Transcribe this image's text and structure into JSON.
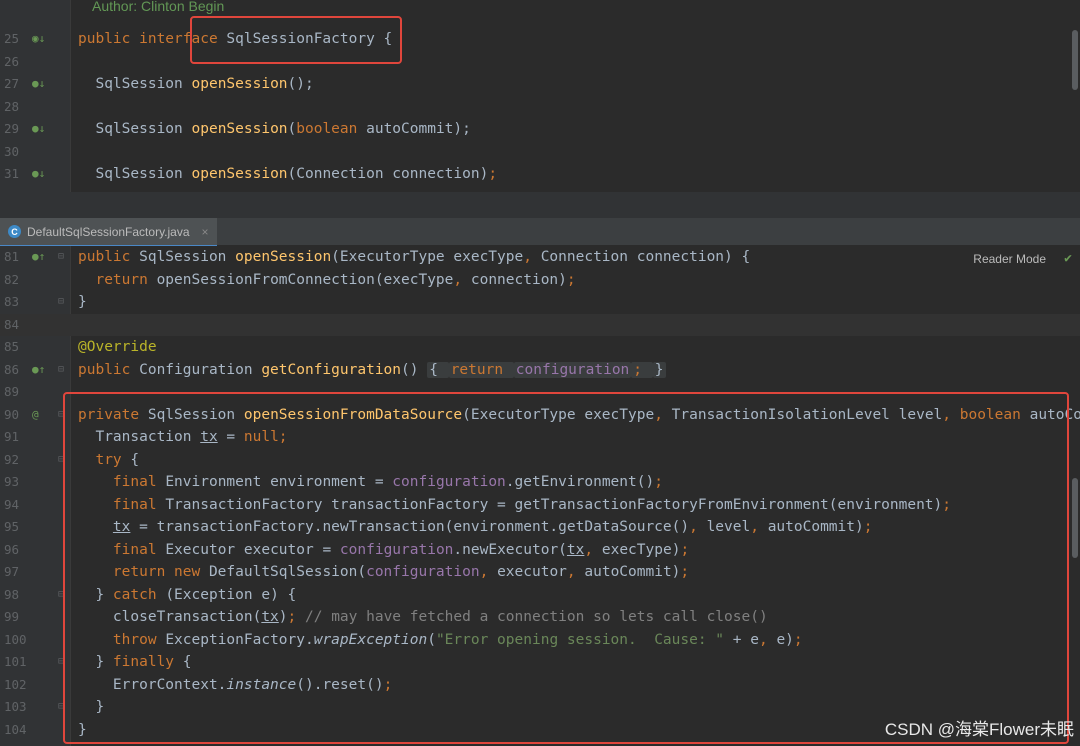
{
  "top": {
    "header_comment": "Author: Clinton Begin",
    "lines": [
      {
        "n": "25",
        "parts": [
          [
            "kw",
            "public interface "
          ],
          [
            "",
            "SqlSessionFactory {"
          ]
        ]
      },
      {
        "n": "26",
        "parts": []
      },
      {
        "n": "27",
        "parts": [
          [
            "",
            "  SqlSession "
          ],
          [
            "fn",
            "openSession"
          ],
          [
            "",
            "();"
          ]
        ]
      },
      {
        "n": "28",
        "parts": []
      },
      {
        "n": "29",
        "parts": [
          [
            "",
            "  SqlSession "
          ],
          [
            "fn",
            "openSession"
          ],
          [
            "",
            "("
          ],
          [
            "kw",
            "boolean "
          ],
          [
            "",
            "autoCommit);"
          ]
        ]
      },
      {
        "n": "30",
        "parts": []
      },
      {
        "n": "31",
        "parts": [
          [
            "",
            "  SqlSession "
          ],
          [
            "fn",
            "openSession"
          ],
          [
            "",
            "(Connection connection)"
          ],
          [
            "kw",
            ";"
          ]
        ]
      }
    ]
  },
  "tab": {
    "label": "DefaultSqlSessionFactory.java",
    "close": "×"
  },
  "reader_mode": "Reader Mode",
  "bottom": {
    "lines": [
      {
        "n": "81",
        "parts": [
          [
            "kw",
            "public "
          ],
          [
            "",
            "SqlSession "
          ],
          [
            "fn",
            "openSession"
          ],
          [
            "",
            "(ExecutorType execType"
          ],
          [
            "kw",
            ", "
          ],
          [
            "",
            "Connection connection) {"
          ]
        ]
      },
      {
        "n": "82",
        "parts": [
          [
            "kw",
            "  return "
          ],
          [
            "",
            "openSessionFromConnection(execType"
          ],
          [
            "kw",
            ", "
          ],
          [
            "",
            "connection)"
          ],
          [
            "kw",
            ";"
          ]
        ]
      },
      {
        "n": "83",
        "parts": [
          [
            "",
            "}"
          ]
        ]
      },
      {
        "n": "84",
        "parts": []
      },
      {
        "n": "85",
        "parts": [
          [
            "ann",
            "@Override"
          ]
        ]
      },
      {
        "n": "86",
        "parts": [
          [
            "kw",
            "public "
          ],
          [
            "",
            "Configuration "
          ],
          [
            "fn",
            "getConfiguration"
          ],
          [
            "",
            "() "
          ],
          [
            "box",
            "{ "
          ],
          [
            "kwbox",
            "return "
          ],
          [
            "fldbox",
            "configuration"
          ],
          [
            "kwbox",
            "; "
          ],
          [
            "box",
            "}"
          ]
        ]
      },
      {
        "n": "89",
        "parts": []
      },
      {
        "n": "90",
        "parts": [
          [
            "kw",
            "private "
          ],
          [
            "",
            "SqlSession "
          ],
          [
            "fn",
            "openSessionFromDataSource"
          ],
          [
            "",
            "(ExecutorType execType"
          ],
          [
            "kw",
            ", "
          ],
          [
            "",
            "TransactionIsolationLevel level"
          ],
          [
            "kw",
            ", boolean "
          ],
          [
            "",
            "autoCommit) {"
          ]
        ]
      },
      {
        "n": "91",
        "parts": [
          [
            "",
            "  Transaction "
          ],
          [
            "ul",
            "tx"
          ],
          [
            "",
            " = "
          ],
          [
            "kw",
            "null;"
          ]
        ]
      },
      {
        "n": "92",
        "parts": [
          [
            "kw",
            "  try "
          ],
          [
            "",
            "{"
          ]
        ]
      },
      {
        "n": "93",
        "parts": [
          [
            "kw",
            "    final "
          ],
          [
            "",
            "Environment environment = "
          ],
          [
            "fld",
            "configuration"
          ],
          [
            "",
            ".getEnvironment()"
          ],
          [
            "kw",
            ";"
          ]
        ]
      },
      {
        "n": "94",
        "parts": [
          [
            "kw",
            "    final "
          ],
          [
            "",
            "TransactionFactory transactionFactory = getTransactionFactoryFromEnvironment(environment)"
          ],
          [
            "kw",
            ";"
          ]
        ]
      },
      {
        "n": "95",
        "parts": [
          [
            "",
            "    "
          ],
          [
            "ul",
            "tx"
          ],
          [
            "",
            " = transactionFactory.newTransaction(environment.getDataSource()"
          ],
          [
            "kw",
            ", "
          ],
          [
            "",
            "level"
          ],
          [
            "kw",
            ", "
          ],
          [
            "",
            "autoCommit)"
          ],
          [
            "kw",
            ";"
          ]
        ]
      },
      {
        "n": "96",
        "parts": [
          [
            "kw",
            "    final "
          ],
          [
            "",
            "Executor executor = "
          ],
          [
            "fld",
            "configuration"
          ],
          [
            "",
            ".newExecutor("
          ],
          [
            "ul",
            "tx"
          ],
          [
            "kw",
            ", "
          ],
          [
            "",
            "execType)"
          ],
          [
            "kw",
            ";"
          ]
        ]
      },
      {
        "n": "97",
        "parts": [
          [
            "kw",
            "    return new "
          ],
          [
            "",
            "DefaultSqlSession("
          ],
          [
            "fld",
            "configuration"
          ],
          [
            "kw",
            ", "
          ],
          [
            "",
            "executor"
          ],
          [
            "kw",
            ", "
          ],
          [
            "",
            "autoCommit)"
          ],
          [
            "kw",
            ";"
          ]
        ]
      },
      {
        "n": "98",
        "parts": [
          [
            "",
            "  } "
          ],
          [
            "kw",
            "catch "
          ],
          [
            "",
            "(Exception e) {"
          ]
        ]
      },
      {
        "n": "99",
        "parts": [
          [
            "",
            "    closeTransaction("
          ],
          [
            "ul",
            "tx"
          ],
          [
            "",
            ")"
          ],
          [
            "kw",
            "; "
          ],
          [
            "cm",
            "// may have fetched a connection so lets call close()"
          ]
        ]
      },
      {
        "n": "100",
        "parts": [
          [
            "kw",
            "    throw "
          ],
          [
            "",
            "ExceptionFactory."
          ],
          [
            "it",
            "wrapException"
          ],
          [
            "",
            "("
          ],
          [
            "str",
            "\"Error opening session.  Cause: \""
          ],
          [
            "",
            " + e"
          ],
          [
            "kw",
            ", "
          ],
          [
            "",
            "e)"
          ],
          [
            "kw",
            ";"
          ]
        ]
      },
      {
        "n": "101",
        "parts": [
          [
            "",
            "  } "
          ],
          [
            "kw",
            "finally "
          ],
          [
            "",
            "{"
          ]
        ]
      },
      {
        "n": "102",
        "parts": [
          [
            "",
            "    ErrorContext."
          ],
          [
            "it",
            "instance"
          ],
          [
            "",
            "().reset()"
          ],
          [
            "kw",
            ";"
          ]
        ]
      },
      {
        "n": "103",
        "parts": [
          [
            "",
            "  }"
          ]
        ]
      },
      {
        "n": "104",
        "parts": [
          [
            "",
            "}"
          ]
        ]
      }
    ]
  },
  "watermark": "CSDN @海棠Flower未眠"
}
